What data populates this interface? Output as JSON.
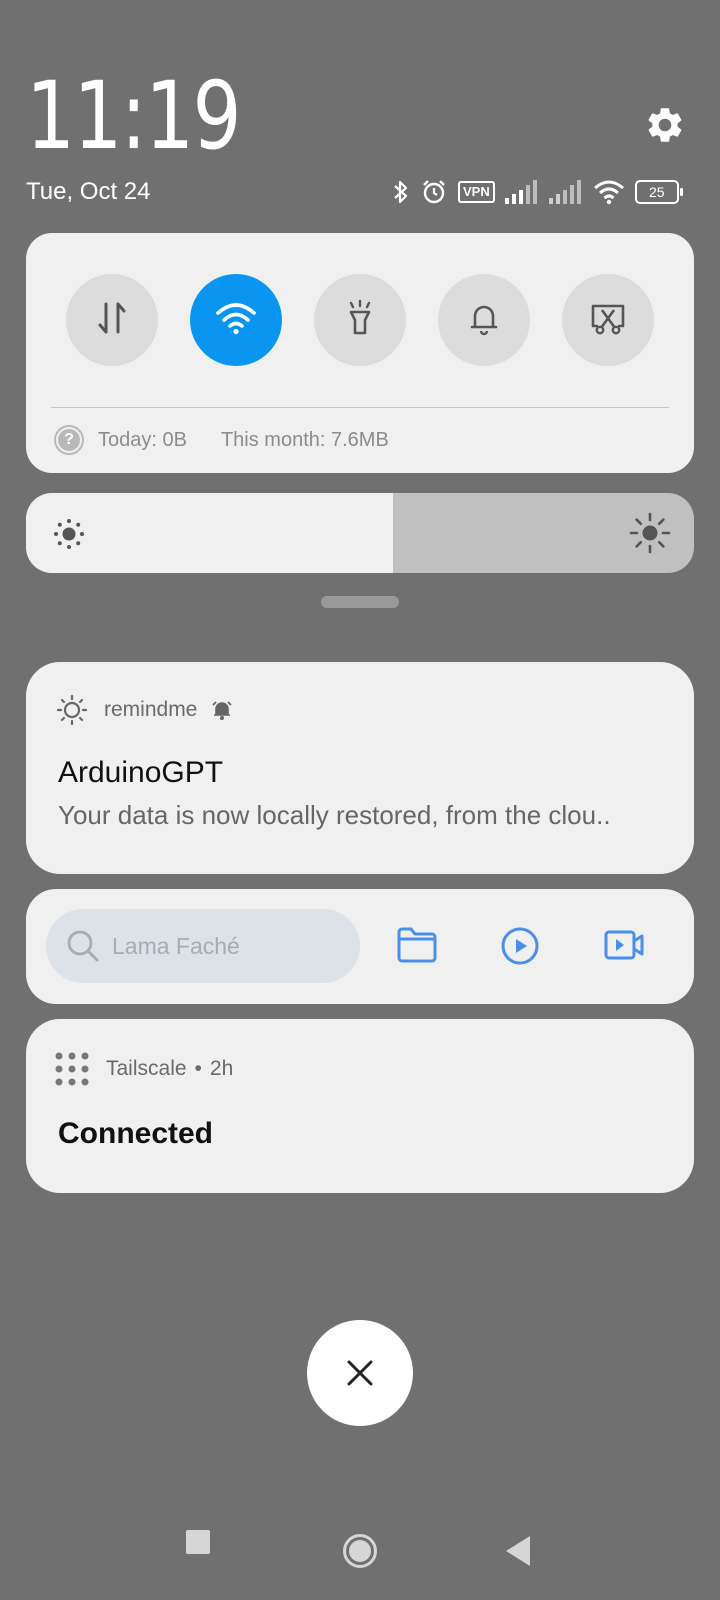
{
  "header": {
    "time": "11:19",
    "date": "Tue, Oct 24",
    "icons": [
      "bluetooth-icon",
      "alarm-icon",
      "vpn-icon",
      "signal-icon",
      "signal-icon",
      "wifi-icon",
      "battery-icon",
      "settings-gear-icon"
    ],
    "vpn_label": "VPN",
    "battery_level": "25"
  },
  "quick_settings": {
    "tiles": [
      {
        "name": "mobile-data",
        "icon": "data-arrows-icon",
        "active": false
      },
      {
        "name": "wifi",
        "icon": "wifi-icon",
        "active": true
      },
      {
        "name": "flashlight",
        "icon": "flashlight-icon",
        "active": false
      },
      {
        "name": "sound",
        "icon": "bell-icon",
        "active": false
      },
      {
        "name": "screenshot",
        "icon": "scissors-icon",
        "active": false
      }
    ],
    "data_today": "Today: 0B",
    "data_month": "This month: 7.6MB",
    "accent": "#0a96f0"
  },
  "brightness": {
    "level_percent": 55
  },
  "notifications": [
    {
      "app": "remindme",
      "title": "ArduinoGPT",
      "text": "Your data is now locally restored, from the clou.."
    },
    {
      "app": "Tailscale",
      "time": "2h",
      "separator": "•",
      "title": "Connected"
    }
  ],
  "media_bar": {
    "search_placeholder": "Lama Faché",
    "accent": "#4a8ee8"
  },
  "nav": [
    "recents-square-icon",
    "home-circle-icon",
    "back-triangle-icon"
  ]
}
